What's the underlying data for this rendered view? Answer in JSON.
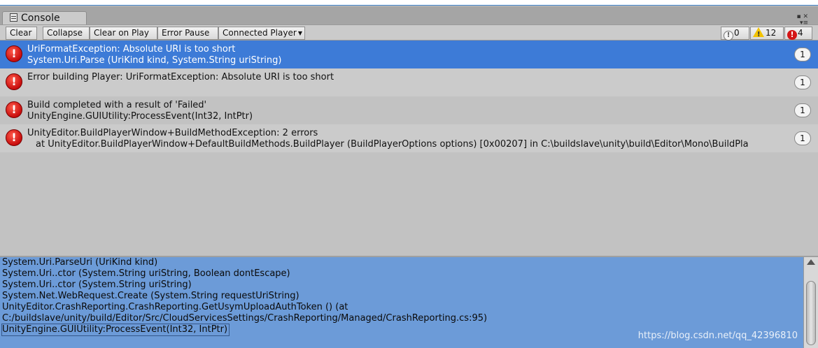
{
  "window": {
    "tab_title": "Console",
    "tab_icon": "console-icon"
  },
  "toolbar": {
    "clear": "Clear",
    "collapse": "Collapse",
    "clear_on_play": "Clear on Play",
    "error_pause": "Error Pause",
    "connected_player": "Connected Player",
    "info_count": "0",
    "warning_count": "12",
    "error_count": "4"
  },
  "log_entries": [
    {
      "line1": "UriFormatException: Absolute URI is too short",
      "line2": "System.Uri.Parse (UriKind kind, System.String uriString)",
      "count": "1",
      "icon": "error-icon",
      "selected": true
    },
    {
      "line1": "Error building Player: UriFormatException: Absolute URI is too short",
      "line2": "",
      "count": "1",
      "icon": "error-icon"
    },
    {
      "line1": "Build completed with a result of 'Failed'",
      "line2": "UnityEngine.GUIUtility:ProcessEvent(Int32, IntPtr)",
      "count": "1",
      "icon": "error-icon"
    },
    {
      "line1": "UnityEditor.BuildPlayerWindow+BuildMethodException: 2 errors",
      "line2": "at UnityEditor.BuildPlayerWindow+DefaultBuildMethods.BuildPlayer (BuildPlayerOptions options) [0x00207] in C:\\buildslave\\unity\\build\\Editor\\Mono\\BuildPla",
      "count": "1",
      "icon": "error-icon"
    }
  ],
  "detail": {
    "lines": [
      "System.Uri.ParseUri (UriKind kind)",
      "System.Uri..ctor (System.String uriString, Boolean dontEscape)",
      "System.Uri..ctor (System.String uriString)",
      "System.Net.WebRequest.Create (System.String requestUriString)",
      "UnityEditor.CrashReporting.CrashReporting.GetUsymUploadAuthToken () (at",
      "C:/buildslave/unity/build/Editor/Src/CloudServicesSettings/CrashReporting/Managed/CrashReporting.cs:95)",
      "UnityEngine.GUIUtility:ProcessEvent(Int32, IntPtr)"
    ],
    "watermark": "https://blog.csdn.net/qq_42396810"
  },
  "colors": {
    "selected_row": "#3d7bd7",
    "detail_bg": "#6c9bd8",
    "error_red": "#d41515",
    "warning_yellow": "#f2c200"
  }
}
